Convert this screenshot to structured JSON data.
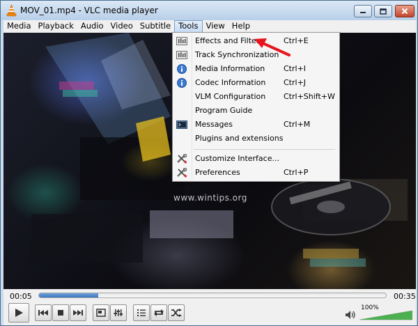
{
  "window": {
    "title": "MOV_01.mp4 - VLC media player",
    "icons": {
      "app": "vlc-cone-icon",
      "minimize": "minimize-icon",
      "maximize": "maximize-icon",
      "close": "close-icon"
    }
  },
  "menubar": {
    "items": [
      "Media",
      "Playback",
      "Audio",
      "Video",
      "Subtitle",
      "Tools",
      "View",
      "Help"
    ],
    "active": "Tools"
  },
  "tools_menu": {
    "items": [
      {
        "label": "Effects and Filters",
        "shortcut": "Ctrl+E",
        "icon": "equalizer-icon"
      },
      {
        "label": "Track Synchronization",
        "shortcut": "",
        "icon": "equalizer-icon"
      },
      {
        "label": "Media Information",
        "shortcut": "Ctrl+I",
        "icon": "info-icon"
      },
      {
        "label": "Codec Information",
        "shortcut": "Ctrl+J",
        "icon": "info-icon"
      },
      {
        "label": "VLM Configuration",
        "shortcut": "Ctrl+Shift+W",
        "icon": ""
      },
      {
        "label": "Program Guide",
        "shortcut": "",
        "icon": ""
      },
      {
        "label": "Messages",
        "shortcut": "Ctrl+M",
        "icon": "terminal-icon"
      },
      {
        "label": "Plugins and extensions",
        "shortcut": "",
        "icon": ""
      },
      {
        "label": "Customize Interface...",
        "shortcut": "",
        "icon": "wrench-screwdriver-icon"
      },
      {
        "label": "Preferences",
        "shortcut": "Ctrl+P",
        "icon": "wrench-screwdriver-icon"
      }
    ]
  },
  "video": {
    "watermark": "www.wintips.org"
  },
  "playback": {
    "elapsed": "00:05",
    "total": "00:35",
    "progress_fraction": 0.17,
    "volume_label": "100%",
    "volume_fraction": 1.0
  },
  "colors": {
    "accent": "#3d76c0",
    "annotation_arrow": "#e8141c",
    "volume_fill": "#4caf50"
  }
}
